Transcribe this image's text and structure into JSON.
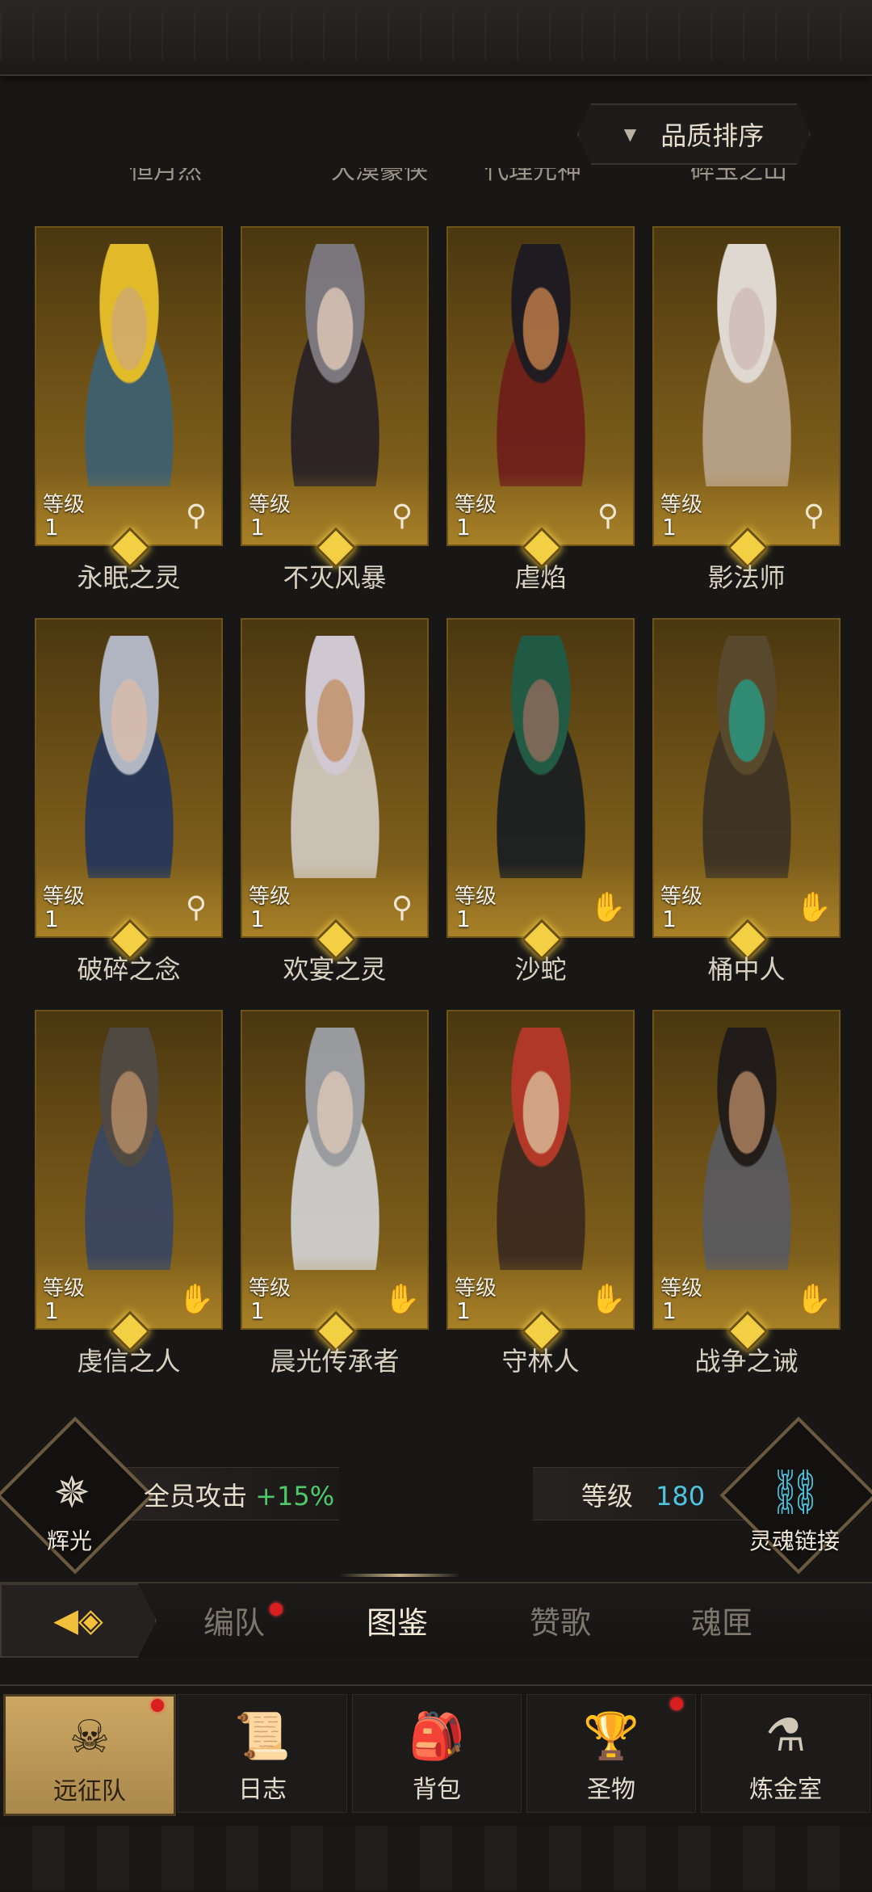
{
  "header": {
    "sort_label": "品质排序",
    "sort_arrow_icon": "triangle-down-icon"
  },
  "partial_names": [
    "恒月然",
    "大漠豪侠",
    "代理元神",
    "碎玉之山"
  ],
  "level_label": "等级",
  "colors": {
    "card_gold": "#8c6a1f",
    "gem": "#f2cf43",
    "bonus_green": "#4fc96a",
    "level_cyan": "#4fc4e0",
    "notification_red": "#d81e1e"
  },
  "heroes": [
    {
      "name": "永眠之灵",
      "level": "1",
      "class_icon": "magnifier-staff-icon",
      "skin": "#d9b26a",
      "hair": "#e9c12b",
      "armor": "#3f6070"
    },
    {
      "name": "不灭风暴",
      "level": "1",
      "class_icon": "magnifier-staff-icon",
      "skin": "#d3c0b6",
      "hair": "#7d7a82",
      "armor": "#2a2226"
    },
    {
      "name": "虐焰",
      "level": "1",
      "class_icon": "magnifier-staff-icon",
      "skin": "#a86f45",
      "hair": "#1c1a22",
      "armor": "#6e1f1a"
    },
    {
      "name": "影法师",
      "level": "1",
      "class_icon": "magnifier-staff-icon",
      "skin": "#d8c7c4",
      "hair": "#e7e1dc",
      "armor": "#b8a38a"
    },
    {
      "name": "破碎之念",
      "level": "1",
      "class_icon": "magnifier-staff-icon",
      "skin": "#d9c1b8",
      "hair": "#b6bccb",
      "armor": "#263659"
    },
    {
      "name": "欢宴之灵",
      "level": "1",
      "class_icon": "magnifier-staff-icon",
      "skin": "#c99f80",
      "hair": "#d7d0dc",
      "armor": "#cfc7bd"
    },
    {
      "name": "沙蛇",
      "level": "1",
      "class_icon": "hand-icon",
      "skin": "#7e6a5a",
      "hair": "#1f5c47",
      "armor": "#1b1f22"
    },
    {
      "name": "桶中人",
      "level": "1",
      "class_icon": "hand-icon",
      "skin": "#2f8f78",
      "hair": "#5a4a2e",
      "armor": "#3d3324"
    },
    {
      "name": "虔信之人",
      "level": "1",
      "class_icon": "hand-icon",
      "skin": "#a88464",
      "hair": "#4f4a45",
      "armor": "#3a4660"
    },
    {
      "name": "晨光传承者",
      "level": "1",
      "class_icon": "hand-icon",
      "skin": "#d6c6bc",
      "hair": "#9da0a6",
      "armor": "#cfcfcf"
    },
    {
      "name": "守林人",
      "level": "1",
      "class_icon": "hand-icon",
      "skin": "#d8a88a",
      "hair": "#b6382a",
      "armor": "#3b2a20"
    },
    {
      "name": "战争之诫",
      "level": "1",
      "class_icon": "hand-icon",
      "skin": "#9a7458",
      "hair": "#1f1b1a",
      "armor": "#5a5a5e"
    }
  ],
  "bonus": {
    "radiance_label": "辉光",
    "radiance_icon": "sword-compass-icon",
    "text": "全员攻击",
    "value": "+15%",
    "level_label": "等级",
    "level_value": "180",
    "soul_link_label": "灵魂链接",
    "soul_link_icon": "chain-link-icon"
  },
  "tabs": {
    "back_icon": "arrow-left-gem-icon",
    "items": [
      "编队",
      "图鉴",
      "赞歌",
      "魂匣"
    ],
    "active": "图鉴"
  },
  "nav": {
    "items": [
      {
        "label": "远征队",
        "icon": "horned-helmet-icon"
      },
      {
        "label": "日志",
        "icon": "scroll-icon"
      },
      {
        "label": "背包",
        "icon": "backpack-icon"
      },
      {
        "label": "圣物",
        "icon": "chalice-icon"
      },
      {
        "label": "炼金室",
        "icon": "alchemy-icon"
      }
    ],
    "active": "远征队"
  }
}
